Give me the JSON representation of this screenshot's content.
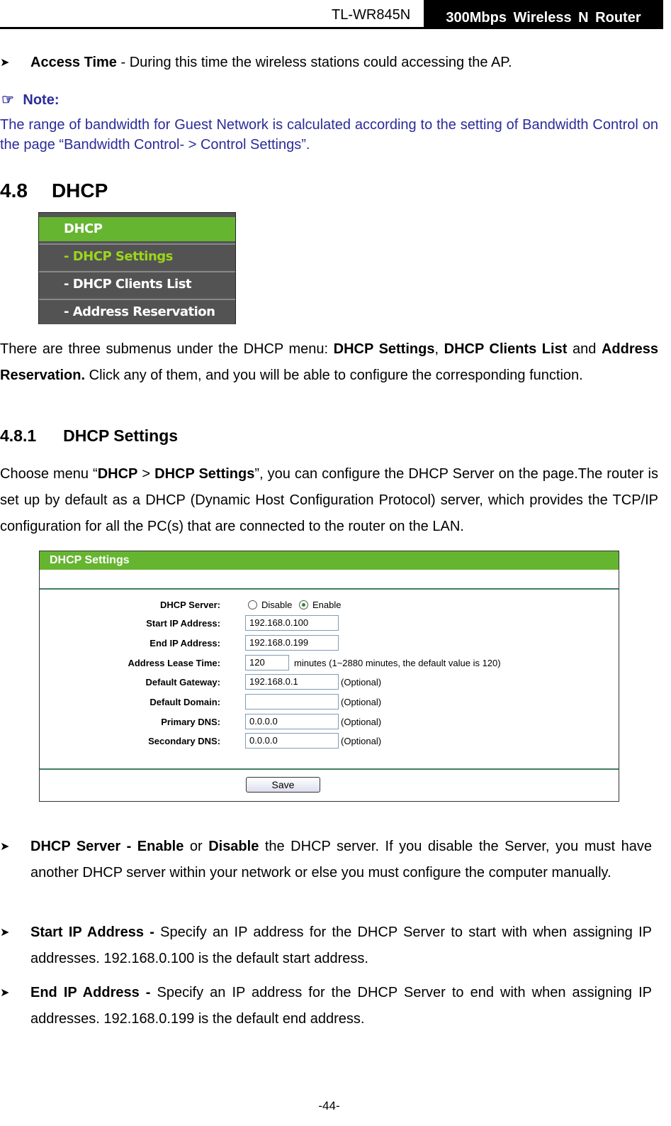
{
  "header": {
    "model": "TL-WR845N",
    "product": "300Mbps  Wireless  N  Router"
  },
  "access_time": {
    "term": "Access Time",
    "text": " - During this time the wireless stations could accessing the AP."
  },
  "note": {
    "label": "Note:",
    "icon": "pointing-hand-icon",
    "text": "The range of bandwidth for Guest Network is calculated according to the setting of Bandwidth Control on the page “Bandwidth Control- > Control Settings”."
  },
  "section": {
    "number": "4.8",
    "title": "DHCP"
  },
  "menu": {
    "head": "DHCP",
    "items": [
      "- DHCP Settings",
      "- DHCP Clients List",
      "- Address Reservation"
    ]
  },
  "intro": {
    "p1": "There are three submenus under the DHCP menu: ",
    "b1": "DHCP Settings",
    "p2": ", ",
    "b2": "DHCP Clients List",
    "p3": " and ",
    "b3": "Address Reservation.",
    "p4": " Click any of them, and you will be able to configure the corresponding function."
  },
  "subsection": {
    "number": "4.8.1",
    "title": "DHCP Settings"
  },
  "choose": {
    "p1": "Choose menu “",
    "b1": "DHCP",
    "p2": " > ",
    "b2": "DHCP Settings",
    "p3": "”, you can configure the DHCP Server on the page.The router is set up by default as a DHCP (Dynamic Host Configuration Protocol) server, which provides the TCP/IP configuration for all the PC(s) that are connected to the router on the LAN."
  },
  "panel": {
    "title": "DHCP Settings",
    "dhcp_server_label": "DHCP Server:",
    "disable_label": "Disable",
    "enable_label": "Enable",
    "dhcp_server_value": "Enable",
    "fields": [
      {
        "label": "Start IP Address:",
        "value": "192.168.0.100",
        "hint": ""
      },
      {
        "label": "End IP Address:",
        "value": "192.168.0.199",
        "hint": ""
      },
      {
        "label": "Address Lease Time:",
        "value": "120",
        "hint": "minutes (1~2880 minutes, the default value is 120)"
      },
      {
        "label": "Default Gateway:",
        "value": "192.168.0.1",
        "hint": "(Optional)"
      },
      {
        "label": "Default Domain:",
        "value": "",
        "hint": "(Optional)"
      },
      {
        "label": "Primary DNS:",
        "value": "0.0.0.0",
        "hint": "(Optional)"
      },
      {
        "label": "Secondary DNS:",
        "value": "0.0.0.0",
        "hint": "(Optional)"
      }
    ],
    "save_label": "Save",
    "accent": "#66b530"
  },
  "bullets": [
    {
      "b1": "DHCP Server - Enable",
      "t1": " or ",
      "b2": "Disable",
      "t2": " the DHCP server. If you disable the Server, you must have another DHCP server within your network or else you must configure the computer manually."
    },
    {
      "b1": "Start IP Address -",
      "t1": " Specify an IP address for the DHCP Server to start with when assigning IP addresses. 192.168.0.100 is the default start address."
    },
    {
      "b1": "End IP Address -",
      "t1": " Specify an IP address for the DHCP Server to end with when assigning IP addresses. 192.168.0.199 is the default end address."
    }
  ],
  "footer": {
    "page": "-44-"
  }
}
